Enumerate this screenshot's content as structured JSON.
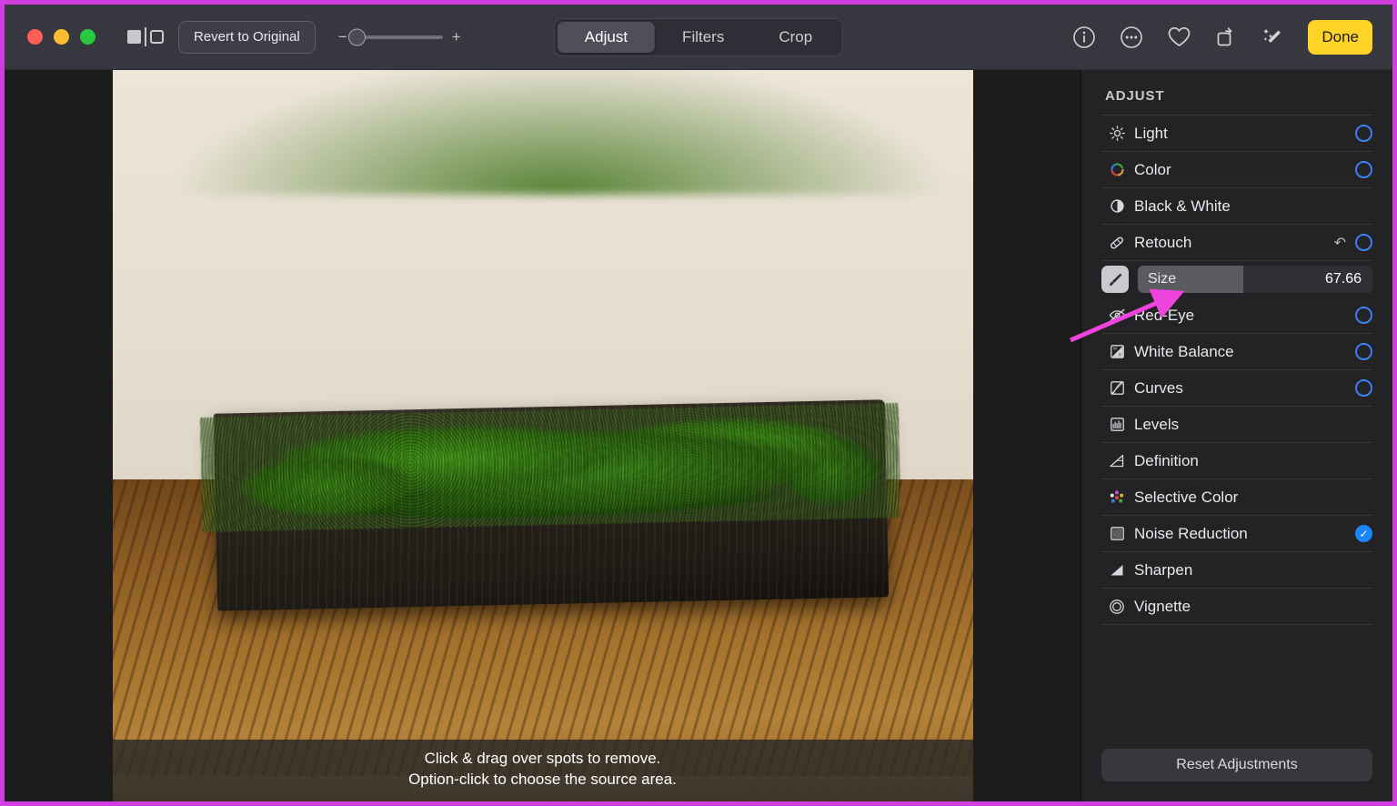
{
  "window": {
    "traffic_lights": [
      "close",
      "minimize",
      "zoom"
    ],
    "compare_icon": "split-compare-icon",
    "revert_label": "Revert to Original",
    "zoom_minus": "−",
    "zoom_plus": "+",
    "zoom_slider_position_pct": 0
  },
  "tabs": [
    {
      "label": "Adjust",
      "active": true
    },
    {
      "label": "Filters",
      "active": false
    },
    {
      "label": "Crop",
      "active": false
    }
  ],
  "right_tools": [
    {
      "name": "info-icon",
      "glyph": "ⓘ"
    },
    {
      "name": "more-options-icon",
      "glyph": "⋯"
    },
    {
      "name": "favorite-heart-icon",
      "glyph": "♡"
    },
    {
      "name": "rotate-icon",
      "glyph": "↻"
    },
    {
      "name": "auto-enhance-icon",
      "glyph": "✦"
    }
  ],
  "done_button": {
    "label": "Done",
    "color": "#ffd426"
  },
  "photo": {
    "caption_line1": "Click & drag over spots to remove.",
    "caption_line2": "Option-click to choose the source area.",
    "subject": "green reindeer moss in a dark wooden planter on a wood table"
  },
  "sidebar": {
    "title": "ADJUST",
    "items": [
      {
        "label": "Light",
        "icon": "sun-icon",
        "expanded": false,
        "toggle": "outline"
      },
      {
        "label": "Color",
        "icon": "color-wheel-icon",
        "expanded": false,
        "toggle": "outline"
      },
      {
        "label": "Black & White",
        "icon": "half-circle-icon",
        "expanded": false,
        "toggle": "none"
      },
      {
        "label": "Retouch",
        "icon": "bandage-icon",
        "expanded": true,
        "toggle": "outline",
        "reset": "↶"
      },
      {
        "label": "Red-Eye",
        "icon": "eye-slash-icon",
        "expanded": false,
        "toggle": "outline"
      },
      {
        "label": "White Balance",
        "icon": "white-balance-icon",
        "expanded": false,
        "toggle": "outline"
      },
      {
        "label": "Curves",
        "icon": "curves-icon",
        "expanded": false,
        "toggle": "outline"
      },
      {
        "label": "Levels",
        "icon": "levels-icon",
        "expanded": false,
        "toggle": "none"
      },
      {
        "label": "Definition",
        "icon": "definition-icon",
        "expanded": false,
        "toggle": "none"
      },
      {
        "label": "Selective Color",
        "icon": "selective-color-icon",
        "expanded": false,
        "toggle": "none"
      },
      {
        "label": "Noise Reduction",
        "icon": "noise-reduction-icon",
        "expanded": false,
        "toggle": "checked"
      },
      {
        "label": "Sharpen",
        "icon": "sharpen-icon",
        "expanded": false,
        "toggle": "none"
      },
      {
        "label": "Vignette",
        "icon": "vignette-icon",
        "expanded": false,
        "toggle": "none"
      }
    ],
    "retouch_slider": {
      "brush_icon": "paintbrush-icon",
      "label": "Size",
      "value": "67.66",
      "fill_pct": 45
    },
    "reset_button_label": "Reset Adjustments"
  },
  "annotation": {
    "color": "#ee44dd",
    "border_color": "#cf3fe0",
    "type": "arrow-pointing-to-size-slider"
  },
  "colors": {
    "titlebar": "#36373f",
    "sidebar": "#232325",
    "canvas": "#1c1c1c",
    "accent_blue": "#1a85ff",
    "done_yellow": "#ffd426"
  }
}
